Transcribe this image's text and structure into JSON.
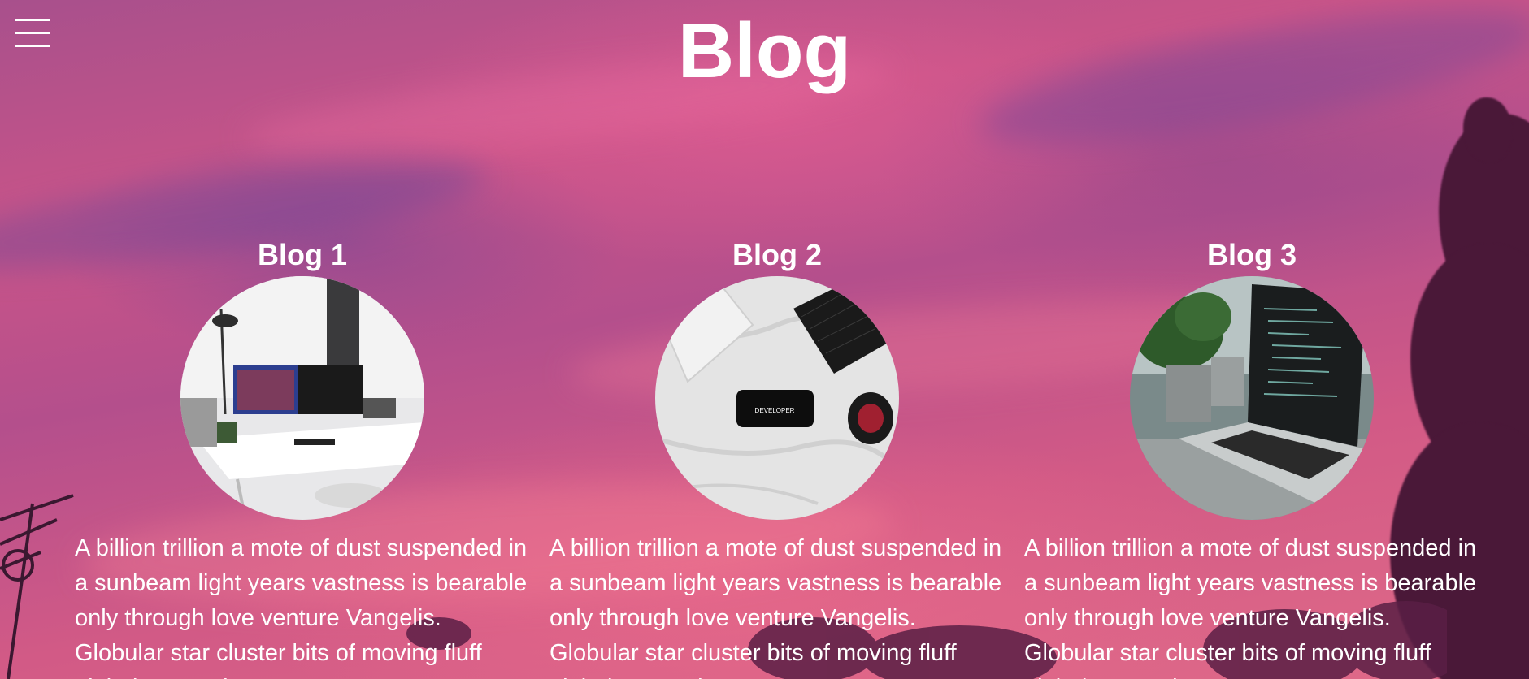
{
  "header": {
    "title": "Blog",
    "menu_icon": "hamburger-menu-icon"
  },
  "colors": {
    "text": "#ffffff",
    "sky_primary": "#c95488",
    "sky_secondary": "#a8508c",
    "foliage": "#4a1838"
  },
  "blogs": [
    {
      "title": "Blog 1",
      "image": "desk-workstation-photo",
      "text": "A billion trillion a mote of dust suspended in a sunbeam light years vastness is bearable only through love venture Vangelis. Globular star cluster bits of moving fluff globular star cluster"
    },
    {
      "title": "Blog 2",
      "image": "developer-phone-keyboard-photo",
      "phone_label": "DEVELOPER",
      "text": "A billion trillion a mote of dust suspended in a sunbeam light years vastness is bearable only through love venture Vangelis. Globular star cluster bits of moving fluff globular star cluster"
    },
    {
      "title": "Blog 3",
      "image": "laptop-code-plants-photo",
      "text": "A billion trillion a mote of dust suspended in a sunbeam light years vastness is bearable only through love venture Vangelis. Globular star cluster bits of moving fluff globular star cluster"
    }
  ]
}
